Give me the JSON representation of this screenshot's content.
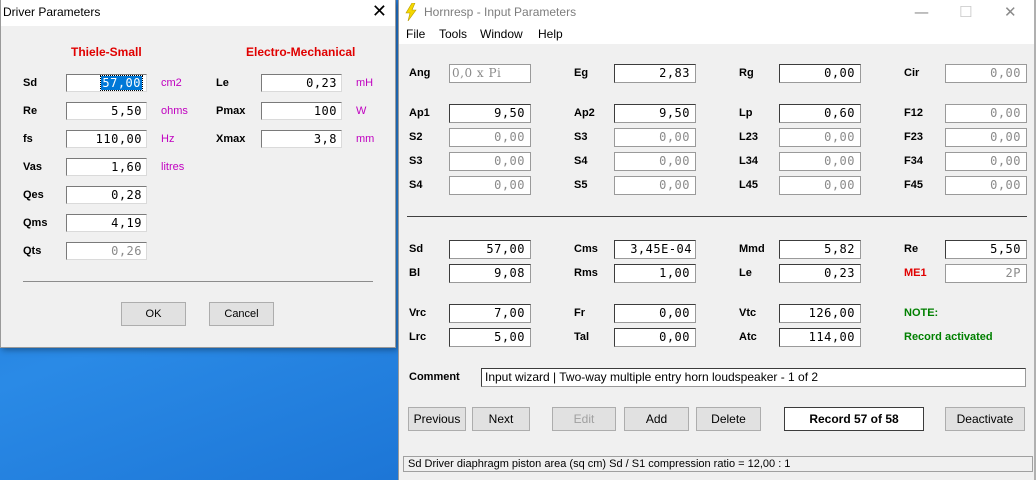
{
  "dialog": {
    "title": "Driver Parameters",
    "close_glyph": "✕",
    "thiele_small_heading": "Thiele-Small",
    "electro_mechanical_heading": "Electro-Mechanical",
    "ts_params": [
      {
        "label": "Sd",
        "value": "57,00",
        "unit": "cm2"
      },
      {
        "label": "Re",
        "value": "5,50",
        "unit": "ohms"
      },
      {
        "label": "fs",
        "value": "110,00",
        "unit": "Hz"
      },
      {
        "label": "Vas",
        "value": "1,60",
        "unit": "litres"
      },
      {
        "label": "Qes",
        "value": "0,28",
        "unit": ""
      },
      {
        "label": "Qms",
        "value": "4,19",
        "unit": ""
      },
      {
        "label": "Qts",
        "value": "0,26",
        "unit": ""
      }
    ],
    "em_params": [
      {
        "label": "Le",
        "value": "0,23",
        "unit": "mH"
      },
      {
        "label": "Pmax",
        "value": "100",
        "unit": "W"
      },
      {
        "label": "Xmax",
        "value": "3,8",
        "unit": "mm"
      }
    ],
    "ok_label": "OK",
    "cancel_label": "Cancel"
  },
  "hornresp": {
    "title": "Hornresp - Input Parameters",
    "icon": "lightning-bolt-icon",
    "window_controls": {
      "minimize": "—",
      "maximize": "☐",
      "close": "✕"
    },
    "menu": [
      "File",
      "Tools",
      "Window",
      "Help"
    ],
    "row_ang": [
      {
        "label": "Ang",
        "value": "0,0 x Pi"
      },
      {
        "label": "Eg",
        "value": "2,83"
      },
      {
        "label": "Rg",
        "value": "0,00"
      },
      {
        "label": "Cir",
        "value": "0,00"
      }
    ],
    "horn_grid": [
      [
        {
          "label": "Ap1",
          "value": "9,50"
        },
        {
          "label": "Ap2",
          "value": "9,50"
        },
        {
          "label": "Lp",
          "value": "0,60"
        },
        {
          "label": "F12",
          "value": "0,00"
        }
      ],
      [
        {
          "label": "S2",
          "value": "0,00"
        },
        {
          "label": "S3",
          "value": "0,00"
        },
        {
          "label": "L23",
          "value": "0,00"
        },
        {
          "label": "F23",
          "value": "0,00"
        }
      ],
      [
        {
          "label": "S3",
          "value": "0,00"
        },
        {
          "label": "S4",
          "value": "0,00"
        },
        {
          "label": "L34",
          "value": "0,00"
        },
        {
          "label": "F34",
          "value": "0,00"
        }
      ],
      [
        {
          "label": "S4",
          "value": "0,00"
        },
        {
          "label": "S5",
          "value": "0,00"
        },
        {
          "label": "L45",
          "value": "0,00"
        },
        {
          "label": "F45",
          "value": "0,00"
        }
      ]
    ],
    "driver_grid": [
      [
        {
          "label": "Sd",
          "value": "57,00"
        },
        {
          "label": "Cms",
          "value": "3,45E-04"
        },
        {
          "label": "Mmd",
          "value": "5,82"
        },
        {
          "label": "Re",
          "value": "5,50"
        }
      ],
      [
        {
          "label": "Bl",
          "value": "9,08"
        },
        {
          "label": "Rms",
          "value": "1,00"
        },
        {
          "label": "Le",
          "value": "0,23"
        },
        {
          "label": "ME1",
          "value": "2P"
        }
      ]
    ],
    "chamber_grid": [
      [
        {
          "label": "Vrc",
          "value": "7,00"
        },
        {
          "label": "Fr",
          "value": "0,00"
        },
        {
          "label": "Vtc",
          "value": "126,00"
        }
      ],
      [
        {
          "label": "Lrc",
          "value": "5,00"
        },
        {
          "label": "Tal",
          "value": "0,00"
        },
        {
          "label": "Atc",
          "value": "114,00"
        }
      ]
    ],
    "note_label": "NOTE:",
    "note_text": "Record activated",
    "comment_label": "Comment",
    "comment_value": "Input wizard | Two-way multiple entry horn loudspeaker  -  1 of 2",
    "buttons": {
      "previous": "Previous",
      "next": "Next",
      "edit": "Edit",
      "add": "Add",
      "delete": "Delete",
      "record": "Record 57 of 58",
      "deactivate": "Deactivate"
    },
    "status": "Sd   Driver diaphragm piston area  (sq cm)   Sd / S1 compression ratio = 12,00 : 1"
  }
}
